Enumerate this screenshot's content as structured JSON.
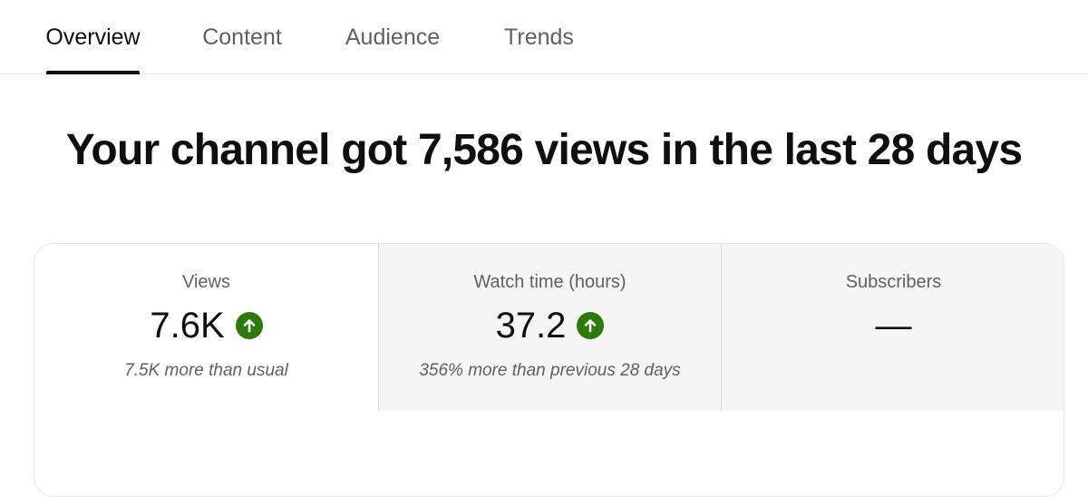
{
  "tabs": [
    {
      "label": "Overview",
      "active": true
    },
    {
      "label": "Content",
      "active": false
    },
    {
      "label": "Audience",
      "active": false
    },
    {
      "label": "Trends",
      "active": false
    }
  ],
  "headline": "Your channel got 7,586 views in the last 28 days",
  "metrics": [
    {
      "label": "Views",
      "value": "7.6K",
      "trend_icon": "arrow-up-circle-icon",
      "note": "7.5K more than usual"
    },
    {
      "label": "Watch time (hours)",
      "value": "37.2",
      "trend_icon": "arrow-up-circle-icon",
      "note": "356% more than previous 28 days"
    },
    {
      "label": "Subscribers",
      "value": "—"
    }
  ],
  "colors": {
    "trend_up": "#2b7a0b",
    "active_tab_underline": "#0f0f0f",
    "selected_metric_bg": "#f5f5f5"
  }
}
